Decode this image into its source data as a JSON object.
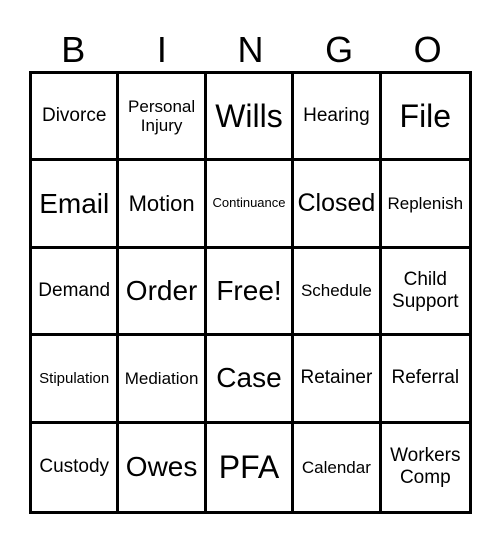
{
  "header": [
    "B",
    "I",
    "N",
    "G",
    "O"
  ],
  "cells": [
    "Divorce",
    "Personal Injury",
    "Wills",
    "Hearing",
    "File",
    "Email",
    "Motion",
    "Continuance",
    "Closed",
    "Replenish",
    "Demand",
    "Order",
    "Free!",
    "Schedule",
    "Child Support",
    "Stipulation",
    "Mediation",
    "Case",
    "Retainer",
    "Referral",
    "Custody",
    "Owes",
    "PFA",
    "Calendar",
    "Workers Comp"
  ]
}
